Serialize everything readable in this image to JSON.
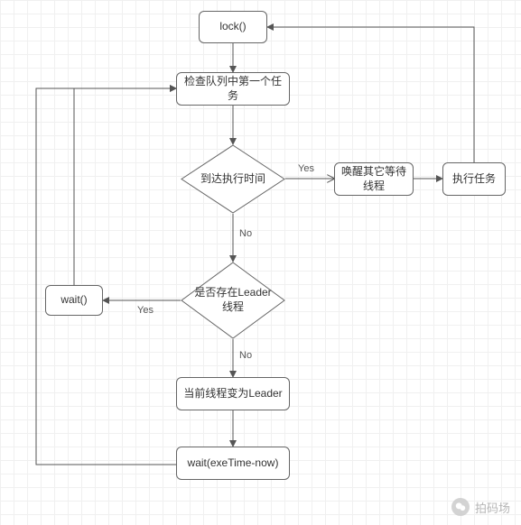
{
  "flow": {
    "nodes": {
      "lock": "lock()",
      "checkFirst": "检查队列中第一个任务",
      "reachedTime": "到达执行时间",
      "wakeOthers": "唤醒其它等待线程",
      "executeTask": "执行任务",
      "leaderExists": "是否存在Leader线程",
      "wait": "wait()",
      "becomeLeader": "当前线程变为Leader",
      "waitExe": "wait(exeTime-now)"
    },
    "edges": {
      "yes1": "Yes",
      "no1": "No",
      "yes2": "Yes",
      "no2": "No"
    }
  },
  "watermark": {
    "text": "拍码场"
  }
}
